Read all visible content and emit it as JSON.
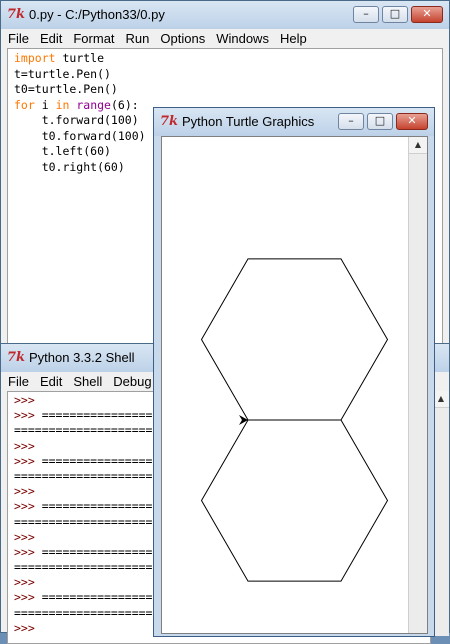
{
  "colors": {
    "keyword": "#ff7700",
    "builtin": "#900090",
    "prompt": "#7a0000",
    "close": "#c5432f"
  },
  "editor_window": {
    "title": "0.py - C:/Python33/0.py",
    "icon": "tk-feather-icon",
    "controls": {
      "minimize": "–",
      "maximize": "□",
      "close": "✕"
    },
    "menu": [
      "File",
      "Edit",
      "Format",
      "Run",
      "Options",
      "Windows",
      "Help"
    ],
    "code": [
      {
        "parts": [
          {
            "t": "import",
            "c": "kw"
          },
          {
            "t": " turtle",
            "c": ""
          }
        ]
      },
      {
        "parts": [
          {
            "t": "t=turtle.Pen()",
            "c": ""
          }
        ]
      },
      {
        "parts": [
          {
            "t": "t0=turtle.Pen()",
            "c": ""
          }
        ]
      },
      {
        "parts": [
          {
            "t": "for",
            "c": "kw"
          },
          {
            "t": " i ",
            "c": ""
          },
          {
            "t": "in",
            "c": "kw"
          },
          {
            "t": " ",
            "c": ""
          },
          {
            "t": "range",
            "c": "bi"
          },
          {
            "t": "(6):",
            "c": ""
          }
        ]
      },
      {
        "parts": [
          {
            "t": "    t.forward(100)",
            "c": ""
          }
        ]
      },
      {
        "parts": [
          {
            "t": "    t0.forward(100)",
            "c": ""
          }
        ]
      },
      {
        "parts": [
          {
            "t": "    t.left(60)",
            "c": ""
          }
        ]
      },
      {
        "parts": [
          {
            "t": "    t0.right(60)",
            "c": ""
          }
        ]
      }
    ]
  },
  "shell_window": {
    "title": "Python 3.3.2 Shell",
    "icon": "tk-feather-icon",
    "menu": [
      "File",
      "Edit",
      "Shell",
      "Debug"
    ],
    "lines": [
      {
        "t": ">>>",
        "c": "prompt"
      },
      {
        "t": ">>> ================================",
        "c": "mixed"
      },
      {
        "t": "================================",
        "c": "sep"
      },
      {
        "t": ">>>",
        "c": "prompt"
      },
      {
        "t": ">>> ================================",
        "c": "mixed"
      },
      {
        "t": "================================",
        "c": "sep"
      },
      {
        "t": ">>>",
        "c": "prompt"
      },
      {
        "t": ">>> ================================",
        "c": "mixed"
      },
      {
        "t": "================================",
        "c": "sep"
      },
      {
        "t": ">>>",
        "c": "prompt"
      },
      {
        "t": ">>> ================================",
        "c": "mixed"
      },
      {
        "t": "================================",
        "c": "sep"
      },
      {
        "t": ">>>",
        "c": "prompt"
      },
      {
        "t": ">>> ================================",
        "c": "mixed"
      },
      {
        "t": "================================",
        "c": "sep"
      },
      {
        "t": ">>>",
        "c": "prompt"
      }
    ]
  },
  "turtle_window": {
    "title": "Python Turtle Graphics",
    "icon": "tk-feather-icon",
    "controls": {
      "minimize": "–",
      "maximize": "□",
      "close": "✕"
    },
    "drawing": {
      "edge_length": 100,
      "turtles": [
        {
          "name": "t",
          "turn": "left",
          "angle": 60
        },
        {
          "name": "t0",
          "turn": "right",
          "angle": 60
        }
      ]
    }
  }
}
